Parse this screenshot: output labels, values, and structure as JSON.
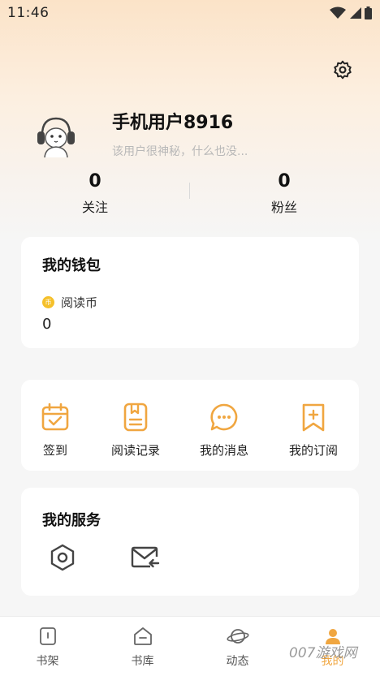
{
  "status_bar": {
    "time": "11:46"
  },
  "profile": {
    "username": "手机用户8916",
    "bio": "该用户很神秘，什么也没..."
  },
  "stats": [
    {
      "value": "0",
      "label": "关注"
    },
    {
      "value": "0",
      "label": "粉丝"
    }
  ],
  "wallet": {
    "title": "我的钱包",
    "coin_icon_text": "币",
    "coin_label": "阅读币",
    "coin_value": "0"
  },
  "features": [
    {
      "label": "签到",
      "icon": "calendar-check-icon"
    },
    {
      "label": "阅读记录",
      "icon": "reading-record-icon"
    },
    {
      "label": "我的消息",
      "icon": "message-icon"
    },
    {
      "label": "我的订阅",
      "icon": "subscribe-icon"
    }
  ],
  "services": {
    "title": "我的服务",
    "items": [
      {
        "icon": "hexagon-settings-icon"
      },
      {
        "icon": "mail-reply-icon"
      }
    ]
  },
  "bottom_nav": [
    {
      "label": "书架",
      "icon": "bookshelf-icon",
      "active": false
    },
    {
      "label": "书库",
      "icon": "library-icon",
      "active": false
    },
    {
      "label": "动态",
      "icon": "planet-icon",
      "active": false
    },
    {
      "label": "我的",
      "icon": "profile-icon",
      "active": true
    }
  ],
  "watermark": "007游戏网",
  "colors": {
    "accent": "#f0a640",
    "coin": "#f5c02a"
  }
}
